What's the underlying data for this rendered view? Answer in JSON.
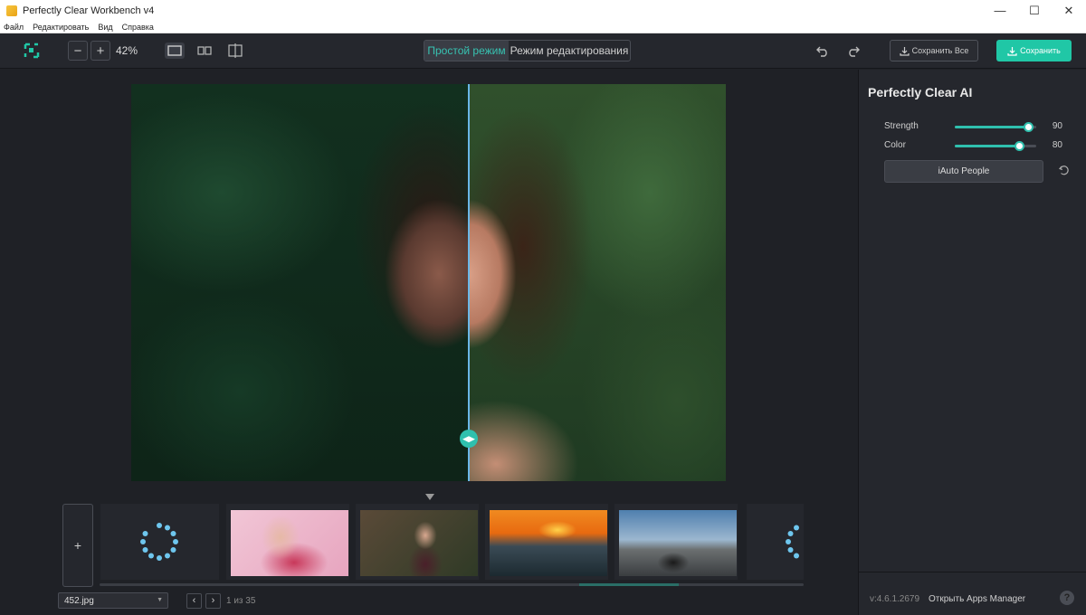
{
  "window": {
    "title": "Perfectly Clear Workbench v4",
    "minimize": "—",
    "maximize": "☐",
    "close": "✕"
  },
  "menu": [
    "Файл",
    "Редактировать",
    "Вид",
    "Справка"
  ],
  "toolbar": {
    "zoom_out": "−",
    "zoom_in": "+",
    "zoom_value": "42%",
    "mode_simple": "Простой режим",
    "mode_edit": "Режим редактирования",
    "save_all": "Сохранить Все",
    "save": "Сохранить",
    "accent": "#20c7a6"
  },
  "panel": {
    "title": "Perfectly Clear AI",
    "sliders": [
      {
        "label": "Strength",
        "value": "90",
        "level": 0.9
      },
      {
        "label": "Color",
        "value": "80",
        "level": 0.8
      }
    ],
    "iauto_button": "iAuto People",
    "version": "v:4.6.1.2679",
    "apps_link": "Открыть Apps Manager",
    "help": "?"
  },
  "filmstrip": {
    "add": "+",
    "thumbnails": [
      "portrait-pink",
      "portrait-forest",
      "sunset-wave",
      "motorcycle-road"
    ]
  },
  "footer": {
    "file_name": "452.jpg",
    "prev": "‹",
    "next": "›",
    "page_count": "1 из 35"
  }
}
